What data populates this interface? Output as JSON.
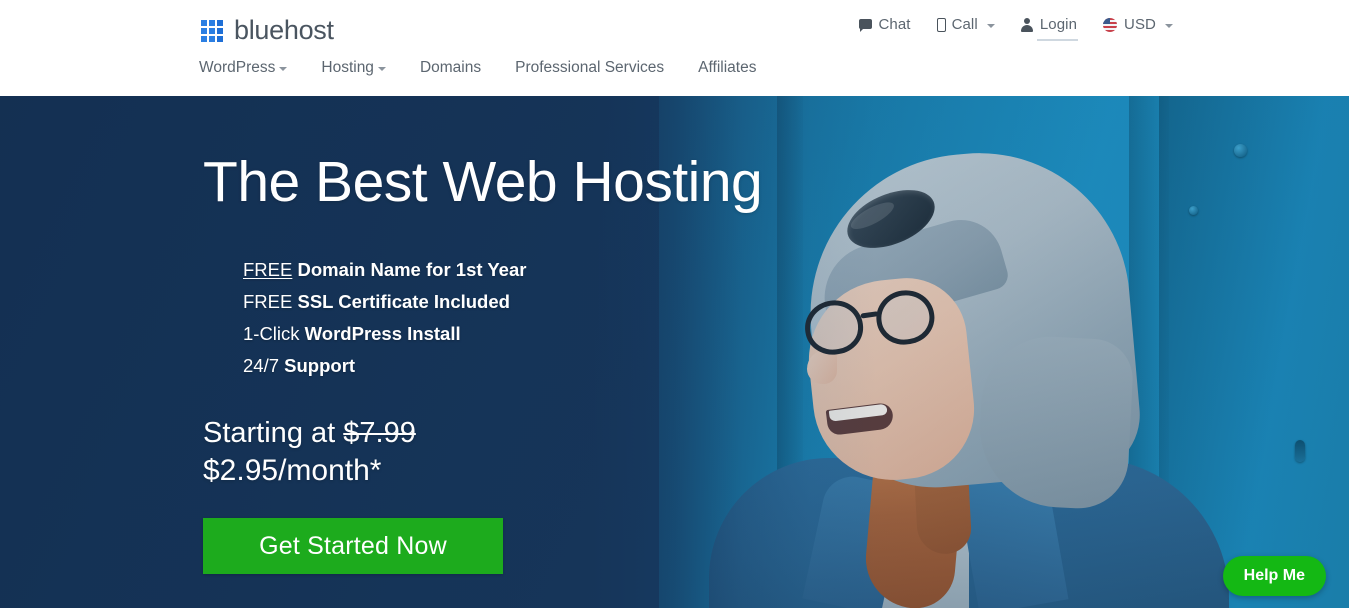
{
  "header": {
    "brand": {
      "name": "bluehost",
      "logo_icon": "grid-squares-icon",
      "logo_color": "#2b7fe3"
    },
    "utility": [
      {
        "label": "Chat",
        "icon": "chat-bubble-icon",
        "caret": false,
        "underlined": false
      },
      {
        "label": "Call",
        "icon": "mobile-phone-icon",
        "caret": true,
        "underlined": false
      },
      {
        "label": "Login",
        "icon": "person-icon",
        "caret": false,
        "underlined": true
      },
      {
        "label": "USD",
        "icon": "us-flag-icon",
        "caret": true,
        "underlined": false
      }
    ],
    "nav": [
      {
        "label": "WordPress",
        "caret": true
      },
      {
        "label": "Hosting",
        "caret": true
      },
      {
        "label": "Domains",
        "caret": false
      },
      {
        "label": "Professional Services",
        "caret": false
      },
      {
        "label": "Affiliates",
        "caret": false
      }
    ]
  },
  "hero": {
    "title": "The Best Web Hosting",
    "features": [
      {
        "lead": "FREE",
        "rest": "Domain Name for 1st Year",
        "underline_lead": true
      },
      {
        "lead": "FREE",
        "rest": "SSL Certificate Included",
        "underline_lead": false
      },
      {
        "lead": "1-Click",
        "rest": "WordPress Install",
        "underline_lead": false
      },
      {
        "lead": "24/7",
        "rest": "Support",
        "underline_lead": false
      }
    ],
    "pricing": {
      "prefix": "Starting at ",
      "old_price": "$7.99",
      "new_price": "$2.95/month*"
    },
    "cta_label": "Get Started Now",
    "cta_color": "#1dab1d",
    "background_color_left": "#173458",
    "background_color_right": "#1a8ec0",
    "image_alt": "smiling-woman-with-glasses-and-beanie"
  },
  "help_widget": {
    "label": "Help Me",
    "color": "#14b814"
  }
}
